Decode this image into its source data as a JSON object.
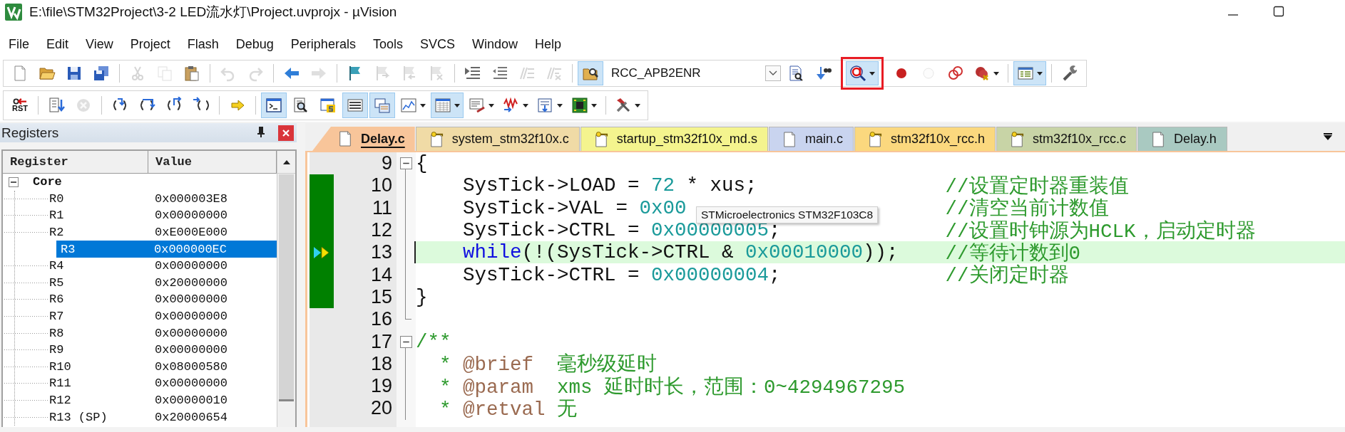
{
  "window": {
    "title": "E:\\file\\STM32Project\\3-2 LED流水灯\\Project.uvprojx - µVision"
  },
  "menu": [
    "File",
    "Edit",
    "View",
    "Project",
    "Flash",
    "Debug",
    "Peripherals",
    "Tools",
    "SVCS",
    "Window",
    "Help"
  ],
  "toolbar_1": [
    {
      "kind": "button",
      "disabled": false
    },
    {
      "kind": "button",
      "disabled": false
    },
    {
      "kind": "button",
      "disabled": false
    },
    {
      "kind": "button",
      "disabled": false
    },
    {
      "kind": "separator"
    },
    {
      "kind": "button",
      "disabled": true
    },
    {
      "kind": "button",
      "disabled": true
    },
    {
      "kind": "button",
      "disabled": false
    },
    {
      "kind": "separator"
    },
    {
      "kind": "button",
      "disabled": true
    },
    {
      "kind": "button",
      "disabled": true
    },
    {
      "kind": "separator"
    },
    {
      "kind": "button",
      "disabled": false
    },
    {
      "kind": "button",
      "disabled": true
    },
    {
      "kind": "separator"
    },
    {
      "kind": "button",
      "disabled": false
    },
    {
      "kind": "button",
      "disabled": true
    },
    {
      "kind": "button",
      "disabled": true
    },
    {
      "kind": "button",
      "disabled": true
    },
    {
      "kind": "separator"
    },
    {
      "kind": "button",
      "disabled": false
    },
    {
      "kind": "button",
      "disabled": false
    },
    {
      "kind": "button",
      "disabled": true
    },
    {
      "kind": "button",
      "disabled": true
    },
    {
      "kind": "separator"
    },
    {
      "kind": "button",
      "disabled": false,
      "pressed": true
    },
    {
      "kind": "combo",
      "value": "RCC_APB2ENR"
    },
    {
      "kind": "button",
      "disabled": false
    },
    {
      "kind": "button",
      "disabled": false
    },
    {
      "kind": "button",
      "disabled": false,
      "pressed": true,
      "dropdown": true,
      "highlighted": true
    },
    {
      "kind": "button",
      "disabled": false
    },
    {
      "kind": "button",
      "disabled": true
    },
    {
      "kind": "button",
      "disabled": false
    },
    {
      "kind": "button",
      "disabled": false,
      "dropdown": true
    },
    {
      "kind": "separator"
    },
    {
      "kind": "button",
      "disabled": false,
      "pressed": true,
      "dropdown": true
    },
    {
      "kind": "separator"
    },
    {
      "kind": "button",
      "disabled": false
    }
  ],
  "toolbar_2": [
    {
      "kind": "button",
      "disabled": false,
      "label": "RST"
    },
    {
      "kind": "separator"
    },
    {
      "kind": "button",
      "disabled": false
    },
    {
      "kind": "button",
      "disabled": true
    },
    {
      "kind": "separator"
    },
    {
      "kind": "button",
      "disabled": false
    },
    {
      "kind": "button",
      "disabled": false
    },
    {
      "kind": "button",
      "disabled": false
    },
    {
      "kind": "button",
      "disabled": false
    },
    {
      "kind": "separator"
    },
    {
      "kind": "button",
      "disabled": false
    },
    {
      "kind": "separator"
    },
    {
      "kind": "button",
      "disabled": false,
      "pressed": true
    },
    {
      "kind": "button",
      "disabled": false
    },
    {
      "kind": "button",
      "disabled": false
    },
    {
      "kind": "button",
      "disabled": false,
      "pressed": true
    },
    {
      "kind": "button",
      "disabled": false,
      "pressed": true
    },
    {
      "kind": "button",
      "disabled": false,
      "dropdown": true
    },
    {
      "kind": "button",
      "disabled": false,
      "pressed": true,
      "dropdown": true
    },
    {
      "kind": "button",
      "disabled": false,
      "dropdown": true
    },
    {
      "kind": "button",
      "disabled": false,
      "dropdown": true
    },
    {
      "kind": "button",
      "disabled": false,
      "dropdown": true
    },
    {
      "kind": "button",
      "disabled": false,
      "dropdown": true
    },
    {
      "kind": "separator"
    },
    {
      "kind": "button",
      "disabled": false,
      "dropdown": true
    }
  ],
  "registers": {
    "title": "Registers",
    "columns": [
      "Register",
      "Value"
    ],
    "tree": [
      {
        "name": "Core",
        "expanded": true,
        "children": [
          {
            "name": "R0",
            "value": "0x000003E8",
            "selected": false
          },
          {
            "name": "R1",
            "value": "0x00000000",
            "selected": false
          },
          {
            "name": "R2",
            "value": "0xE000E000",
            "selected": false
          },
          {
            "name": "R3",
            "value": "0x000000EC",
            "selected": true
          },
          {
            "name": "R4",
            "value": "0x00000000",
            "selected": false
          },
          {
            "name": "R5",
            "value": "0x20000000",
            "selected": false
          },
          {
            "name": "R6",
            "value": "0x00000000",
            "selected": false
          },
          {
            "name": "R7",
            "value": "0x00000000",
            "selected": false
          },
          {
            "name": "R8",
            "value": "0x00000000",
            "selected": false
          },
          {
            "name": "R9",
            "value": "0x00000000",
            "selected": false
          },
          {
            "name": "R10",
            "value": "0x08000580",
            "selected": false
          },
          {
            "name": "R11",
            "value": "0x00000000",
            "selected": false
          },
          {
            "name": "R12",
            "value": "0x00000010",
            "selected": false
          },
          {
            "name": "R13 (SP)",
            "value": "0x20000654",
            "selected": false
          }
        ]
      }
    ]
  },
  "editor": {
    "tabs": [
      {
        "label": "Delay.c",
        "selected": true,
        "read_only": false,
        "color": "#f8c59a"
      },
      {
        "label": "system_stm32f10x.c",
        "selected": false,
        "read_only": true,
        "color": "#f0dba6"
      },
      {
        "label": "startup_stm32f10x_md.s",
        "selected": false,
        "read_only": true,
        "color": "#f4f48e"
      },
      {
        "label": "main.c",
        "selected": false,
        "read_only": false,
        "color": "#c9d4ef"
      },
      {
        "label": "stm32f10x_rcc.h",
        "selected": false,
        "read_only": true,
        "color": "#fbd87e"
      },
      {
        "label": "stm32f10x_rcc.c",
        "selected": false,
        "read_only": true,
        "color": "#c8d4a6"
      },
      {
        "label": "Delay.h",
        "selected": false,
        "read_only": false,
        "color": "#a9c9c1"
      }
    ],
    "lines": [
      {
        "number": "9",
        "kind": "top",
        "fold_start": true,
        "fold_end": false,
        "executed": false,
        "current": false,
        "tokens": [
          {
            "text": "{",
            "kind": "plain"
          }
        ]
      },
      {
        "number": "10",
        "kind": "statement",
        "fold_start": false,
        "fold_end": false,
        "executed": true,
        "current": false,
        "tokens": [
          {
            "text": "SysTick->LOAD = ",
            "kind": "plain"
          },
          {
            "text": "72",
            "kind": "number"
          },
          {
            "text": " * xus;",
            "kind": "plain"
          }
        ],
        "comment": "//设置定时器重装值"
      },
      {
        "number": "11",
        "kind": "statement",
        "fold_start": false,
        "fold_end": false,
        "executed": true,
        "current": false,
        "tokens": [
          {
            "text": "SysTick->VAL = ",
            "kind": "plain"
          },
          {
            "text": "0x00",
            "kind": "number"
          }
        ],
        "comment": "//清空当前计数值"
      },
      {
        "number": "12",
        "kind": "statement",
        "fold_start": false,
        "fold_end": false,
        "executed": true,
        "current": false,
        "tokens": [
          {
            "text": "SysTick->CTRL = ",
            "kind": "plain"
          },
          {
            "text": "0x00000005",
            "kind": "number"
          },
          {
            "text": ";",
            "kind": "plain"
          }
        ],
        "comment": "//设置时钟源为HCLK，启动定时器"
      },
      {
        "number": "13",
        "kind": "statement",
        "fold_start": false,
        "fold_end": false,
        "executed": true,
        "current": true,
        "tokens": [
          {
            "text": "while",
            "kind": "keyword"
          },
          {
            "text": "(!(SysTick->CTRL & ",
            "kind": "plain"
          },
          {
            "text": "0x00010000",
            "kind": "number"
          },
          {
            "text": "));",
            "kind": "plain"
          }
        ],
        "comment": "//等待计数到0"
      },
      {
        "number": "14",
        "kind": "statement",
        "fold_start": false,
        "fold_end": false,
        "executed": true,
        "current": false,
        "tokens": [
          {
            "text": "SysTick->CTRL = ",
            "kind": "plain"
          },
          {
            "text": "0x00000004",
            "kind": "number"
          },
          {
            "text": ";",
            "kind": "plain"
          }
        ],
        "comment": "//关闭定时器"
      },
      {
        "number": "15",
        "kind": "top",
        "fold_start": false,
        "fold_end": false,
        "executed": true,
        "current": false,
        "tokens": [
          {
            "text": "}",
            "kind": "plain"
          }
        ]
      },
      {
        "number": "16",
        "kind": "top",
        "fold_start": false,
        "fold_end": true,
        "executed": false,
        "current": false
      },
      {
        "number": "17",
        "kind": "top",
        "fold_start": true,
        "fold_end": false,
        "executed": false,
        "current": false,
        "tokens": [
          {
            "text": "/**",
            "kind": "comment"
          }
        ]
      },
      {
        "number": "18",
        "kind": "doc",
        "fold_start": false,
        "fold_end": false,
        "executed": false,
        "current": false,
        "tokens": [
          {
            "text": "* ",
            "kind": "comment"
          },
          {
            "text": "@brief",
            "kind": "doctag"
          },
          {
            "text": "  毫秒级延时",
            "kind": "comment"
          }
        ]
      },
      {
        "number": "19",
        "kind": "doc",
        "fold_start": false,
        "fold_end": false,
        "executed": false,
        "current": false,
        "tokens": [
          {
            "text": "* ",
            "kind": "comment"
          },
          {
            "text": "@param",
            "kind": "doctag"
          },
          {
            "text": "  xms 延时时长，范围：0~4294967295",
            "kind": "comment"
          }
        ]
      },
      {
        "number": "20",
        "kind": "doc",
        "fold_start": false,
        "fold_end": false,
        "executed": false,
        "current": false,
        "tokens": [
          {
            "text": "* ",
            "kind": "comment"
          },
          {
            "text": "@retval",
            "kind": "doctag"
          },
          {
            "text": " 无",
            "kind": "comment"
          }
        ]
      }
    ],
    "tooltip": "STMicroelectronics STM32F103C8"
  }
}
